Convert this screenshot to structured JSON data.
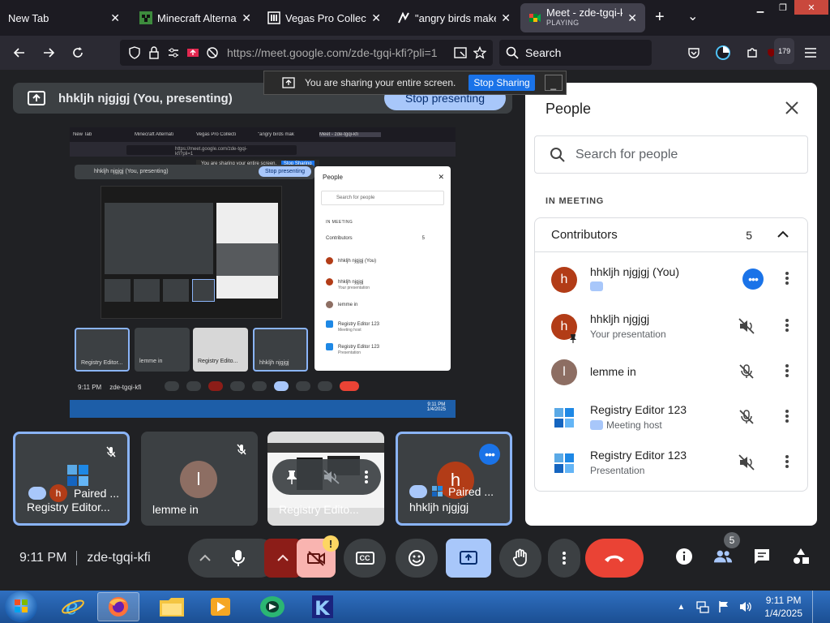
{
  "browser": {
    "tabs": [
      {
        "label": "New Tab"
      },
      {
        "label": "Minecraft Alternati"
      },
      {
        "label": "Vegas Pro Collectio"
      },
      {
        "label": "\"angry birds maker"
      },
      {
        "label": "Meet - zde-tgqi-kfi",
        "sub": "PLAYING"
      }
    ],
    "url": "https://meet.google.com/zde-tgqi-kfi?pli=1",
    "search_placeholder": "Search",
    "extension_badge": "179"
  },
  "sharing_bar": {
    "text": "You are sharing your entire screen.",
    "stop_label": "Stop Sharing",
    "minimize_label": "_"
  },
  "banner": {
    "text": "hhkljh njgjgj (You, presenting)",
    "stop_label": "Stop presenting"
  },
  "screenshare": {
    "tabs": [
      "New Tab",
      "Minecraft Alternati",
      "Vegas Pro Collecti",
      "\"angry birds mak",
      "Meet - zde-tgqi-kfi"
    ],
    "url": "https://meet.google.com/zde-tgqi-kfi?pli=1",
    "banner_text": "hhkljh njgjgj (You, presenting)",
    "banner_stop": "Stop presenting",
    "share_text": "You are sharing your entire screen.",
    "share_stop": "Stop Sharing",
    "people_title": "People",
    "people_search": "Search for people",
    "in_meeting": "IN MEETING",
    "contributors": "Contributors",
    "contributors_count": "5",
    "rows": [
      {
        "name": "hhkljh njgjgj (You)",
        "sub": ""
      },
      {
        "name": "hhkljh njgjgj",
        "sub": "Your presentation"
      },
      {
        "name": "lemme in",
        "sub": ""
      },
      {
        "name": "Registry Editor 123",
        "sub": "Meeting host"
      },
      {
        "name": "Registry Editor 123",
        "sub": "Presentation"
      }
    ],
    "tiles": [
      "Registry Editor...",
      "lemme in",
      "Registry Edito...",
      "hhkljh njgjgj"
    ],
    "time": "9:11 PM",
    "code": "zde-tgqi-kfi",
    "clock_time": "9:11 PM",
    "clock_date": "1/4/2025"
  },
  "tiles": [
    {
      "name": "Registry Editor...",
      "paired": "Paired ...",
      "avatar": "h",
      "selected": true
    },
    {
      "name": "lemme in",
      "avatar": "l",
      "selected": false
    },
    {
      "name": "Registry Edito..."
    },
    {
      "name": "hhkljh njgjgj",
      "paired": "Paired ...",
      "avatar": "h",
      "selected": true
    }
  ],
  "people": {
    "title": "People",
    "search_placeholder": "Search for people",
    "section": "IN MEETING",
    "group_label": "Contributors",
    "group_count": "5",
    "rows": [
      {
        "name": "hhkljh njgjgj (You)",
        "sub": "",
        "avatar": "h"
      },
      {
        "name": "hhkljh njgjgj",
        "sub": "Your presentation",
        "avatar": "h"
      },
      {
        "name": "lemme in",
        "sub": "",
        "avatar": "l"
      },
      {
        "name": "Registry Editor 123",
        "sub": "Meeting host",
        "avatar": ""
      },
      {
        "name": "Registry Editor 123",
        "sub": "Presentation",
        "avatar": ""
      }
    ]
  },
  "controls": {
    "time": "9:11 PM",
    "meeting_code": "zde-tgqi-kfi",
    "people_count": "5",
    "camera_warning": "!",
    "cc_label": "CC"
  },
  "taskbar": {
    "time": "9:11 PM",
    "date": "1/4/2025"
  },
  "colors": {
    "accent_blue": "#1a73e8",
    "avatar_red": "#b23c17",
    "avatar_brown": "#8d6e63",
    "end_call_red": "#ea4335",
    "present_blue": "#a8c7fa"
  }
}
